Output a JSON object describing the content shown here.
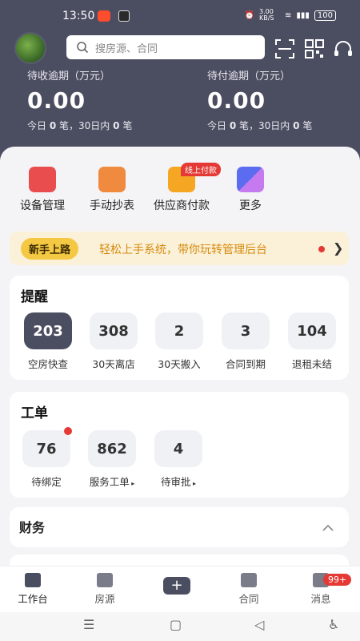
{
  "status": {
    "time": "13:50",
    "speed": "3.00 KB/S",
    "battery": "100"
  },
  "search": {
    "placeholder": "搜房源、合同"
  },
  "receivable": {
    "label": "待收逾期（万元）",
    "amount": "0.00",
    "today_prefix": "今日",
    "today_count": "0",
    "today_suffix": "笔，30日内",
    "month_count": "0",
    "month_suffix": "笔"
  },
  "payable": {
    "label": "待付逾期（万元）",
    "amount": "0.00",
    "today_prefix": "今日",
    "today_count": "0",
    "today_suffix": "笔，30日内",
    "month_count": "0",
    "month_suffix": "笔"
  },
  "quick": [
    {
      "label": "设备管理",
      "icon": "device-icon",
      "color": "#e94d4d"
    },
    {
      "label": "手动抄表",
      "icon": "meter-icon",
      "color": "#f08a3e"
    },
    {
      "label": "供应商付款",
      "icon": "supplier-icon",
      "color": "#f5a623"
    },
    {
      "label": "更多",
      "icon": "more-icon",
      "color": "#5b6cf0"
    }
  ],
  "pay_tag": "线上付款",
  "banner": {
    "tag": "新手上路",
    "text": "轻松上手系统，带你玩转管理后台"
  },
  "reminder": {
    "title": "提醒",
    "items": [
      {
        "value": "203",
        "label": "空房快查"
      },
      {
        "value": "308",
        "label": "30天离店"
      },
      {
        "value": "2",
        "label": "30天搬入"
      },
      {
        "value": "3",
        "label": "合同到期"
      },
      {
        "value": "104",
        "label": "退租未结"
      }
    ]
  },
  "workorder": {
    "title": "工单",
    "items": [
      {
        "value": "76",
        "label": "待绑定"
      },
      {
        "value": "862",
        "label": "服务工单"
      },
      {
        "value": "4",
        "label": "待审批"
      }
    ]
  },
  "finance": {
    "title": "财务"
  },
  "tabs": [
    "工作台",
    "房源",
    "合同",
    "消息"
  ],
  "message_badge": "99+",
  "colors": {
    "header": "#4b4d60",
    "accent_red": "#e53935",
    "banner_text": "#d68a0c"
  }
}
